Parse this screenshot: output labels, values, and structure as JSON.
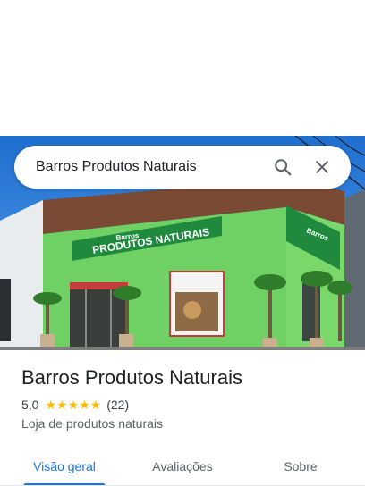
{
  "search": {
    "query": "Barros Produtos Naturais",
    "search_icon": "search-icon",
    "close_icon": "close-icon"
  },
  "photo": {
    "sign_small": "Barros",
    "sign_large": "PRODUTOS NATURAIS"
  },
  "place": {
    "title": "Barros Produtos Naturais",
    "rating": "5,0",
    "stars": "★★★★★",
    "reviews": "(22)",
    "category": "Loja de produtos naturais"
  },
  "tabs": [
    {
      "label": "Visão geral",
      "active": true
    },
    {
      "label": "Avaliações",
      "active": false
    },
    {
      "label": "Sobre",
      "active": false
    }
  ],
  "colors": {
    "accent": "#1a73e8",
    "star": "#fbbc04",
    "wall_green": "#6fd163",
    "sign_green": "#1f8a3e"
  }
}
